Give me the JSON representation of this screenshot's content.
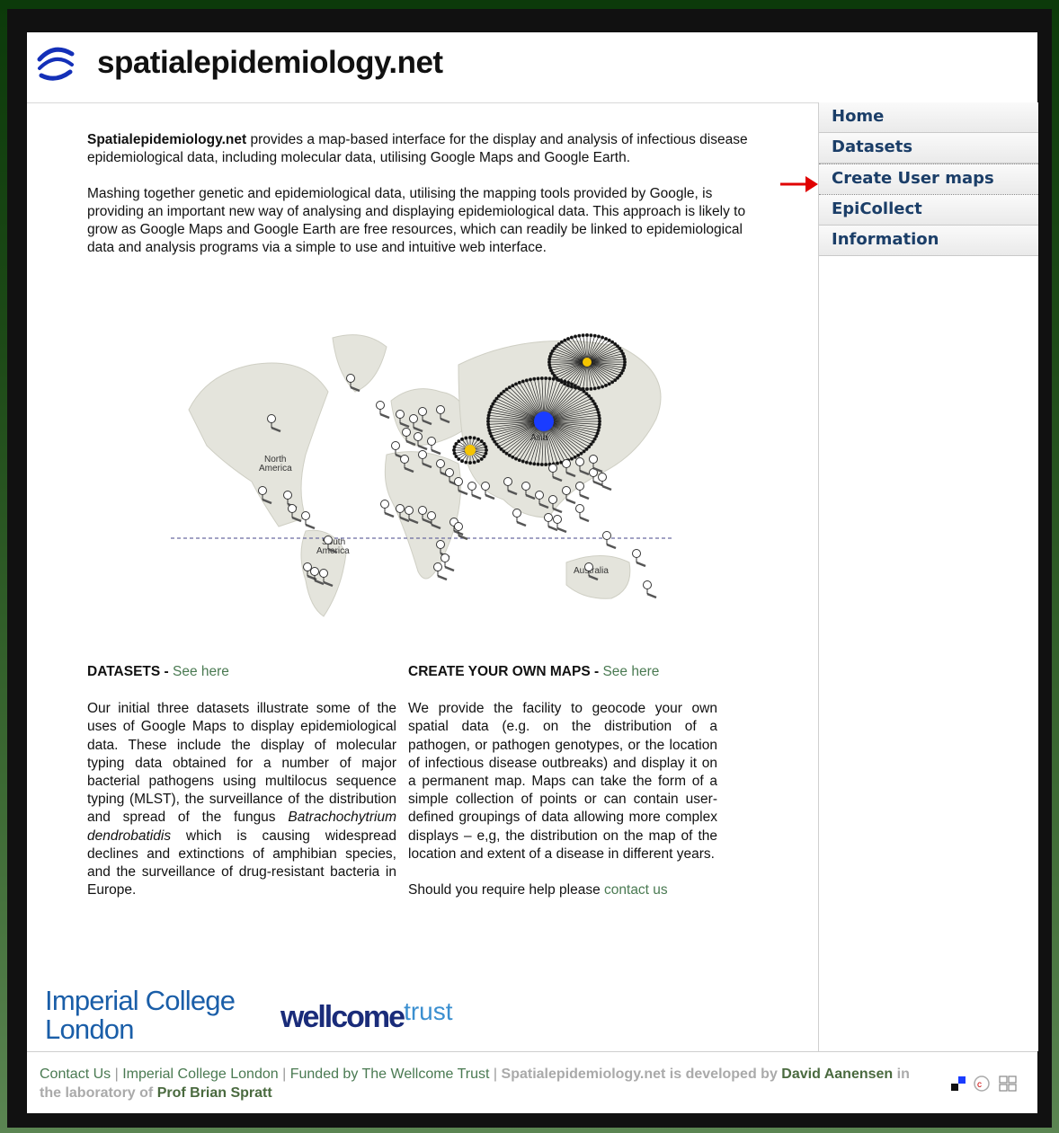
{
  "site": {
    "title": "spatialepidemiology.net"
  },
  "nav": {
    "items": [
      {
        "label": "Home"
      },
      {
        "label": "Datasets"
      },
      {
        "label": "Create User maps"
      },
      {
        "label": "EpiCollect"
      },
      {
        "label": "Information"
      }
    ]
  },
  "intro": {
    "p1_bold": "Spatialepidemiology.net",
    "p1_rest": " provides a map-based interface for the display and analysis of infectious disease epidemiological data, including molecular data, utilising Google Maps and Google Earth.",
    "p2": "Mashing together genetic and epidemiological data, utilising the mapping tools provided by Google, is providing an important new way of analysing and displaying epidemiological data. This approach is likely to grow as Google Maps and Google Earth are free resources, which can readily be linked to epidemiological data and analysis programs via a simple to use and intuitive web interface."
  },
  "map": {
    "labels": [
      "North America",
      "South America",
      "Asia",
      "Australia"
    ],
    "accent_colors": {
      "hub": "#1a3cff",
      "node": "#f5c400"
    }
  },
  "datasets": {
    "heading": "DATASETS",
    "link": "See here",
    "text_before": "Our initial three datasets illustrate some of the uses of Google Maps to display epidemiological data.  These include the display of molecular typing data obtained for a number of major bacterial pathogens using multilocus sequence typing (MLST), the surveillance of the distribution and spread of the fungus ",
    "italic": "Batrachochytrium dendrobatidis",
    "text_after": " which is causing widespread declines and extinctions of amphibian species, and the surveillance of drug-resistant bacteria in Europe."
  },
  "create": {
    "heading": "CREATE YOUR OWN MAPS",
    "link": "See here",
    "text": "We provide the facility to geocode your own spatial data (e.g. on the distribution of a pathogen, or pathogen genotypes, or the location of infectious disease outbreaks) and display it on a permanent map. Maps can take the form of a simple collection of points or can contain user-defined groupings of data allowing more complex displays – e,g, the distribution on the map of the location and extent of a disease in different years.",
    "help_text": "Should you require help please ",
    "help_link": "contact us"
  },
  "logos": {
    "imperial_line1": "Imperial College",
    "imperial_line2": "London",
    "wellcome": "wellcome",
    "trust": "trust"
  },
  "footer": {
    "contact": "Contact Us",
    "imperial": "Imperial College London",
    "funded": "Funded by The Wellcome Trust",
    "dev_pre": "Spatialepidemiology.net is developed by",
    "dev_name": "David Aanensen",
    "lab_pre": "in the laboratory of",
    "lab_name": "Prof Brian Spratt"
  },
  "colors": {
    "nav_text": "#1b3e68",
    "link": "#4a7a52",
    "arrow": "#e00000"
  }
}
